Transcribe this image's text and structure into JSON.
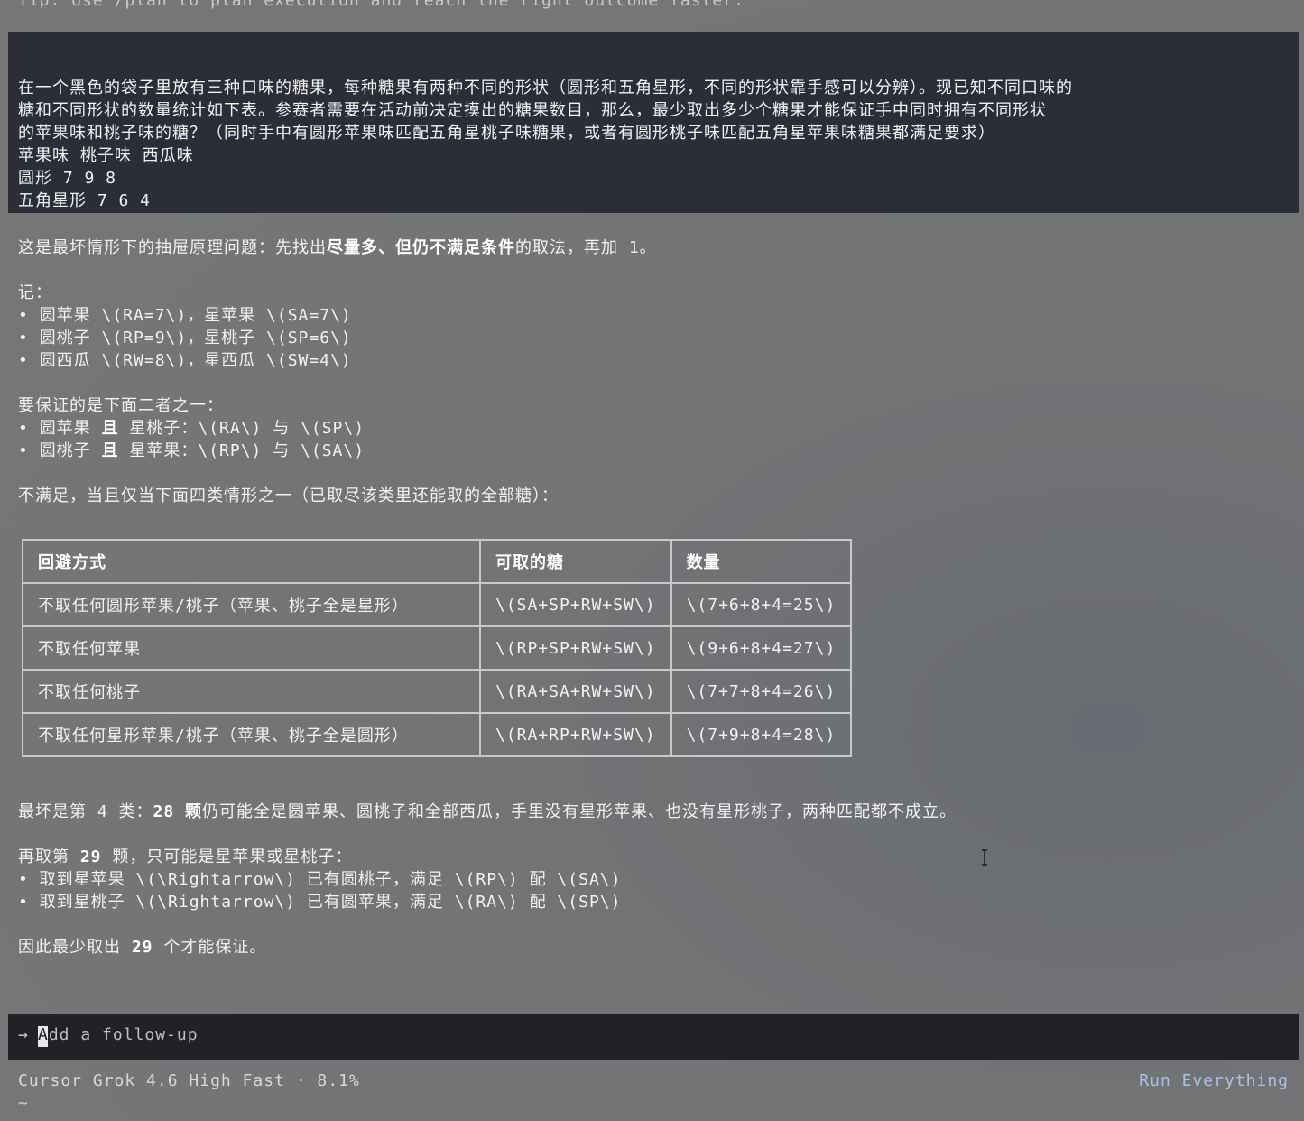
{
  "tip": "Tip: Use /plan to plan execution and reach the right outcome faster.",
  "prompt": {
    "lines": [
      "在一个黑色的袋子里放有三种口味的糖果，每种糖果有两种不同的形状（圆形和五角星形，不同的形状靠手感可以分辨）。现已知不同口味的",
      "糖和不同形状的数量统计如下表。参赛者需要在活动前决定摸出的糖果数目，那么，最少取出多少个糖果才能保证手中同时拥有不同形状",
      "的苹果味和桃子味的糖？（同时手中有圆形苹果味匹配五角星桃子味糖果，或者有圆形桃子味匹配五角星苹果味糖果都满足要求）",
      "苹果味 桃子味 西瓜味",
      "圆形 7 9 8",
      "五角星形 7 6 4"
    ]
  },
  "answer": {
    "intro_a": "这是最坏情形下的抽屉原理问题：先找出",
    "intro_bold": "尽量多、但仍不满足条件",
    "intro_b": "的取法，再加 1。",
    "notation_label": "记：",
    "notation": [
      "• 圆苹果 \\(RA=7\\)，星苹果 \\(SA=7\\)",
      "• 圆桃子 \\(RP=9\\)，星桃子 \\(SP=6\\)",
      "• 圆西瓜 \\(RW=8\\)，星西瓜 \\(SW=4\\)"
    ],
    "guarantee_label": "要保证的是下面二者之一：",
    "guarantee": [
      {
        "a": "• 圆苹果 ",
        "bold": "且",
        "b": " 星桃子：\\(RA\\) 与 \\(SP\\)"
      },
      {
        "a": "• 圆桃子 ",
        "bold": "且",
        "b": " 星苹果：\\(RP\\) 与 \\(SA\\)"
      }
    ],
    "cases_label": "不满足，当且仅当下面四类情形之一（已取尽该类里还能取的全部糖）：",
    "table": {
      "headers": [
        "回避方式",
        "可取的糖",
        "数量"
      ],
      "rows": [
        [
          "不取任何圆形苹果/桃子（苹果、桃子全是星形）",
          "\\(SA+SP+RW+SW\\)",
          "\\(7+6+8+4=25\\)"
        ],
        [
          "不取任何苹果",
          "\\(RP+SP+RW+SW\\)",
          "\\(9+6+8+4=27\\)"
        ],
        [
          "不取任何桃子",
          "\\(RA+SA+RW+SW\\)",
          "\\(7+7+8+4=26\\)"
        ],
        [
          "不取任何星形苹果/桃子（苹果、桃子全是圆形）",
          "\\(RA+RP+RW+SW\\)",
          "\\(7+9+8+4=28\\)"
        ]
      ]
    },
    "worst_a": "最坏是第 4 类：",
    "worst_bold": "28 颗",
    "worst_b": "仍可能全是圆苹果、圆桃子和全部西瓜，手里没有星形苹果、也没有星形桃子，两种匹配都不成立。",
    "next_a": "再取第 ",
    "next_bold": "29",
    "next_b": " 颗，只可能是星苹果或星桃子：",
    "next_items": [
      "• 取到星苹果 \\(\\Rightarrow\\) 已有圆桃子，满足 \\(RP\\) 配 \\(SA\\)",
      "• 取到星桃子 \\(\\Rightarrow\\) 已有圆苹果，满足 \\(RA\\) 配 \\(SP\\)"
    ],
    "concl_a": "因此最少取出 ",
    "concl_bold": "29",
    "concl_b": " 个才能保证。"
  },
  "followup": {
    "arrow": "→",
    "placeholder_first": "A",
    "placeholder_rest": "dd a follow-up"
  },
  "status": {
    "model": "Cursor Grok 4.6 High Fast · 8.1%",
    "run_mode": "Run Everything",
    "tilde": "~"
  }
}
